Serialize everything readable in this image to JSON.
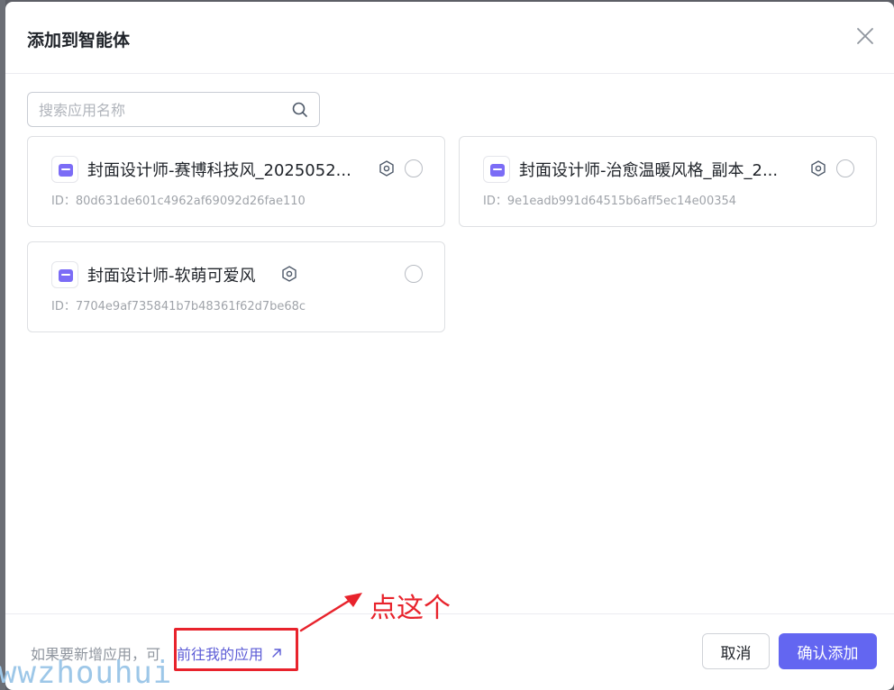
{
  "dialog": {
    "title": "添加到智能体"
  },
  "search": {
    "placeholder": "搜索应用名称"
  },
  "apps": [
    {
      "name": "封面设计师-赛博科技风_2025052...",
      "id": "ID：80d631de601c4962af69092d26fae110"
    },
    {
      "name": "封面设计师-治愈温暖风格_副本_2...",
      "id": "ID：9e1eadb991d64515b6aff5ec14e00354"
    },
    {
      "name": "封面设计师-软萌可爱风",
      "id": "ID：7704e9af735841b7b48361f62d7be68c"
    }
  ],
  "footer": {
    "hint_text": "如果要新增应用，可",
    "link_text": "前往我的应用",
    "cancel_label": "取消",
    "confirm_label": "确认添加"
  },
  "annotation": {
    "text": "点这个"
  },
  "watermark": {
    "text": "wwzhouhui"
  },
  "colors": {
    "accent": "#6366f1",
    "annotation_red": "#e8232c",
    "app_icon": "#7b6cf6"
  }
}
